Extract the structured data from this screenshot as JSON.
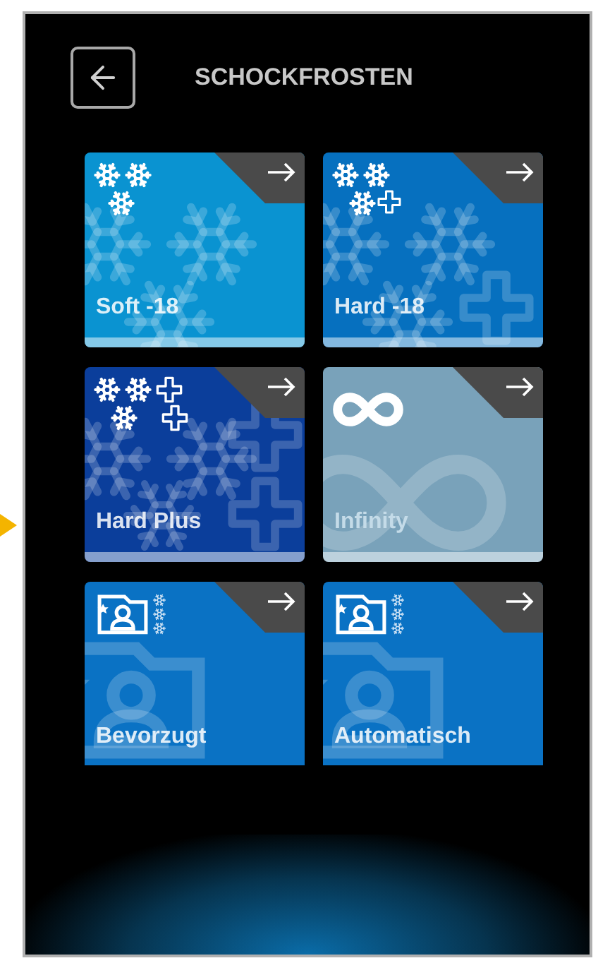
{
  "header": {
    "title": "SCHOCKFROSTEN"
  },
  "tiles": [
    {
      "kind": "soft",
      "label": "Soft -18",
      "color": "#0a93d1",
      "disabled": false
    },
    {
      "kind": "hard",
      "label": "Hard -18",
      "color": "#0670bf",
      "disabled": false
    },
    {
      "kind": "hardplus",
      "label": "Hard Plus",
      "color": "#0b3e9b",
      "disabled": false
    },
    {
      "kind": "infinity",
      "label": "Infinity",
      "color": "#79a2ba",
      "disabled": true
    },
    {
      "kind": "favorite",
      "label": "Bevorzugt",
      "color": "#0a72c4",
      "disabled": false
    },
    {
      "kind": "auto",
      "label": "Automatisch",
      "color": "#0a72c4",
      "disabled": false
    }
  ]
}
